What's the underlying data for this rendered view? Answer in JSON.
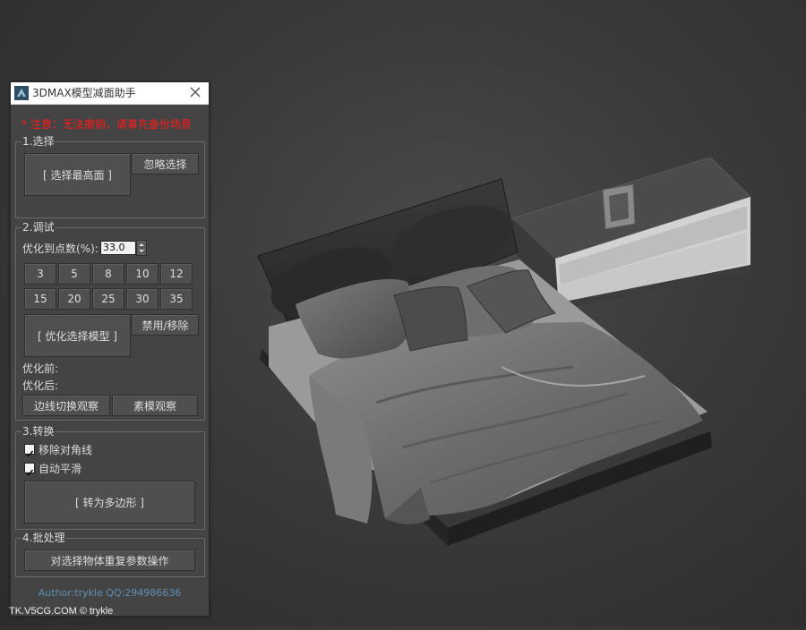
{
  "window": {
    "title": "3DMAX模型减面助手",
    "warning": "* 注意：无法撤销，请事先备份场景"
  },
  "section_select": {
    "legend": "1.选择",
    "select_highest_button": "[ 选择最高面 ]",
    "ignore_select_button": "忽略选择"
  },
  "section_debug": {
    "legend": "2.调试",
    "optimize_label": "优化到点数(%):",
    "optimize_value": "33.0",
    "presets_row1": [
      "3",
      "5",
      "8",
      "10",
      "12"
    ],
    "presets_row2": [
      "15",
      "20",
      "25",
      "30",
      "35"
    ],
    "optimize_model_button": "[ 优化选择模型 ]",
    "disable_remove_button": "禁用/移除",
    "before_label": "优化前:",
    "after_label": "优化后:",
    "edge_toggle_button": "边线切换观察",
    "plain_view_button": "素模观察"
  },
  "section_convert": {
    "legend": "3.转换",
    "remove_diagonal_label": "移除对角线",
    "remove_diagonal_checked": true,
    "auto_smooth_label": "自动平滑",
    "auto_smooth_checked": true,
    "convert_poly_button": "[ 转为多边形 ]"
  },
  "section_batch": {
    "legend": "4.批处理",
    "batch_button": "对选择物体重复参数操作"
  },
  "footer": {
    "author": "Author:trykle QQ:294986636"
  },
  "watermark": "TK.V5CG.COM © trykle",
  "colors": {
    "panel_bg": "#444444",
    "warning": "#ff1a1a",
    "author_link": "#5f8fb0"
  }
}
